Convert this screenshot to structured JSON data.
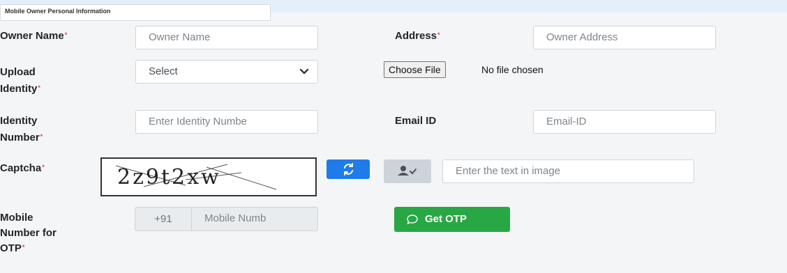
{
  "section_title": "Mobile Owner Personal Information",
  "required_marker": "*",
  "fields": {
    "owner_name": {
      "label": "Owner Name",
      "placeholder": "Owner Name"
    },
    "address": {
      "label": "Address",
      "placeholder": "Owner Address"
    },
    "upload_identity": {
      "label_line1": "Upload",
      "label_line2": "Identity",
      "selected": "Select"
    },
    "file": {
      "button": "Choose File",
      "status": "No file chosen"
    },
    "identity_number": {
      "label_line1": "Identity",
      "label_line2": "Number",
      "placeholder": "Enter Identity Numbe"
    },
    "email": {
      "label": "Email ID",
      "placeholder": "Email-ID"
    },
    "captcha": {
      "label": "Captcha",
      "image_text": "2z9t2xw",
      "input_placeholder": "Enter the text in image"
    },
    "mobile": {
      "label_line1": "Mobile",
      "label_line2": "Number for",
      "label_line3": "OTP",
      "country_code": "+91",
      "placeholder": "Mobile Numb"
    }
  },
  "buttons": {
    "get_otp": "Get OTP"
  },
  "colors": {
    "primary": "#1f7bea",
    "success": "#28a745",
    "required": "#e8433a"
  }
}
